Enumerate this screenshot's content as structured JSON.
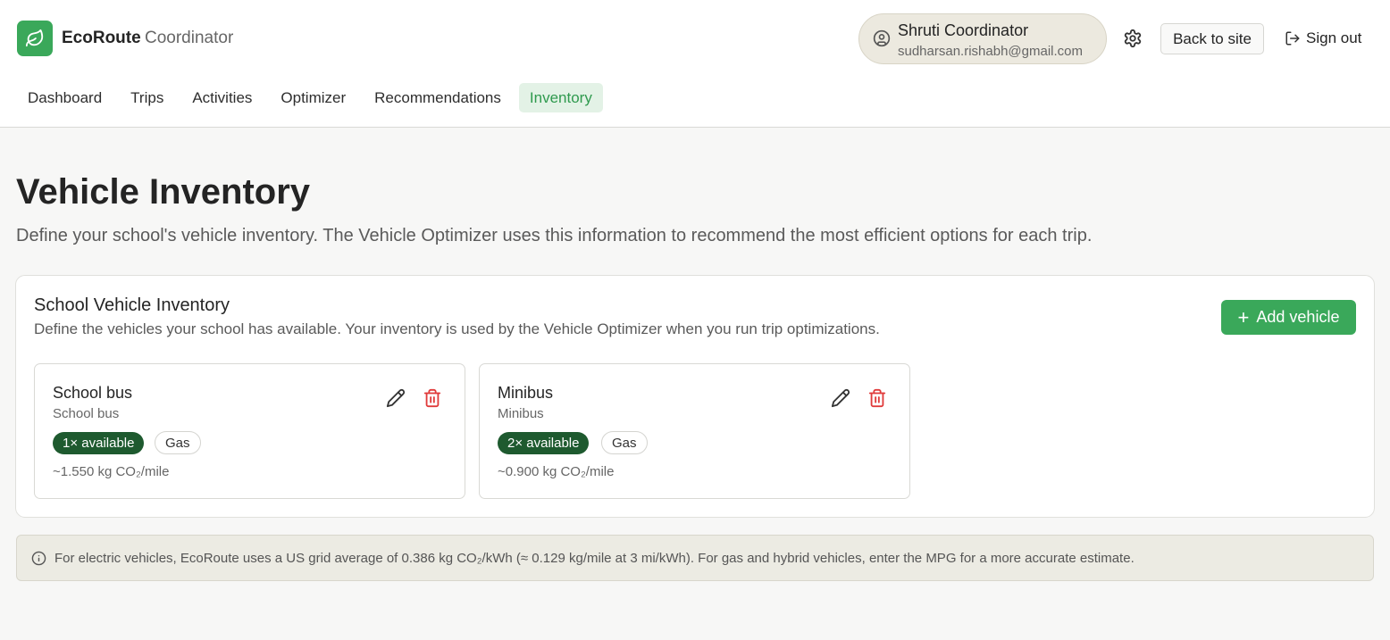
{
  "brand": {
    "name": "EcoRoute",
    "subtitle": "Coordinator",
    "logo_icon": "leaf-icon",
    "color": "#3aa85a"
  },
  "user": {
    "name": "Shruti Coordinator",
    "email": "sudharsan.rishabh@gmail.com",
    "icon": "user-circle-icon"
  },
  "header_actions": {
    "settings_icon": "gear-icon",
    "back_label": "Back to site",
    "signout_label": "Sign out",
    "signout_icon": "sign-out-icon"
  },
  "nav": {
    "items": [
      {
        "label": "Dashboard"
      },
      {
        "label": "Trips"
      },
      {
        "label": "Activities"
      },
      {
        "label": "Optimizer"
      },
      {
        "label": "Recommendations"
      },
      {
        "label": "Inventory",
        "active": true
      }
    ]
  },
  "page": {
    "title": "Vehicle Inventory",
    "subtitle": "Define your school's vehicle inventory. The Vehicle Optimizer uses this information to recommend the most efficient options for each trip."
  },
  "inventory": {
    "title": "School Vehicle Inventory",
    "description": "Define the vehicles your school has available. Your inventory is used by the Vehicle Optimizer when you run trip optimizations.",
    "add_label": "Add vehicle",
    "vehicles": [
      {
        "name": "School bus",
        "type": "School bus",
        "availability": "1× available",
        "fuel": "Gas",
        "emissions": "~1.550 kg CO₂/mile"
      },
      {
        "name": "Minibus",
        "type": "Minibus",
        "availability": "2× available",
        "fuel": "Gas",
        "emissions": "~0.900 kg CO₂/mile"
      }
    ]
  },
  "info": {
    "icon": "info-icon",
    "text": "For electric vehicles, EcoRoute uses a US grid average of 0.386 kg CO₂/kWh (≈ 0.129 kg/mile at 3 mi/kWh). For gas and hybrid vehicles, enter the MPG for a more accurate estimate."
  },
  "colors": {
    "accent": "#3aa85a",
    "badge_dark": "#1e5a2f",
    "delete": "#e03b3b"
  }
}
